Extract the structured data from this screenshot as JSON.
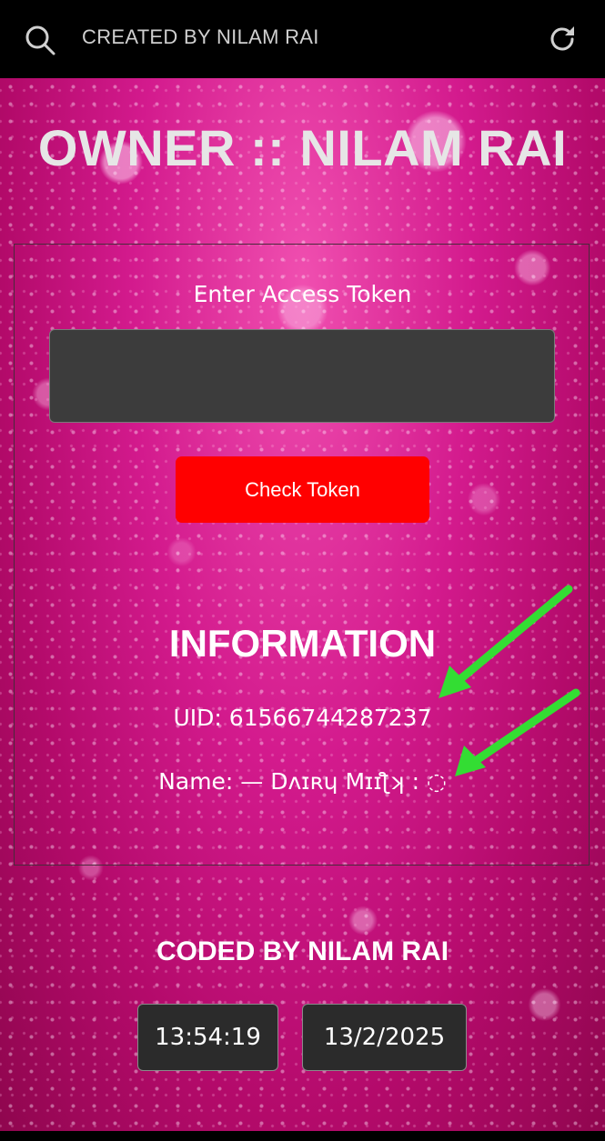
{
  "topbar": {
    "title": "CREATED BY NILAM RAI",
    "search_icon": "search-icon",
    "reload_icon": "reload-icon"
  },
  "header": {
    "owner": "OWNER :: NILAM RAI"
  },
  "form": {
    "token_label": "Enter Access Token",
    "token_value": "",
    "check_button": "Check Token"
  },
  "info": {
    "title": "INFORMATION",
    "uid": "UID: 61566744287237",
    "name": "Name: — Dᴧɪʀɥ Mɪɪƪʞ : ◌"
  },
  "footer": {
    "coded_by": "CODED BY NILAM RAI",
    "time": "13:54:19",
    "date": "13/2/2025"
  },
  "colors": {
    "button": "#ff0000",
    "input_bg": "#3c3c3c",
    "arrow": "#33dd33",
    "background": "#d31a8d"
  }
}
